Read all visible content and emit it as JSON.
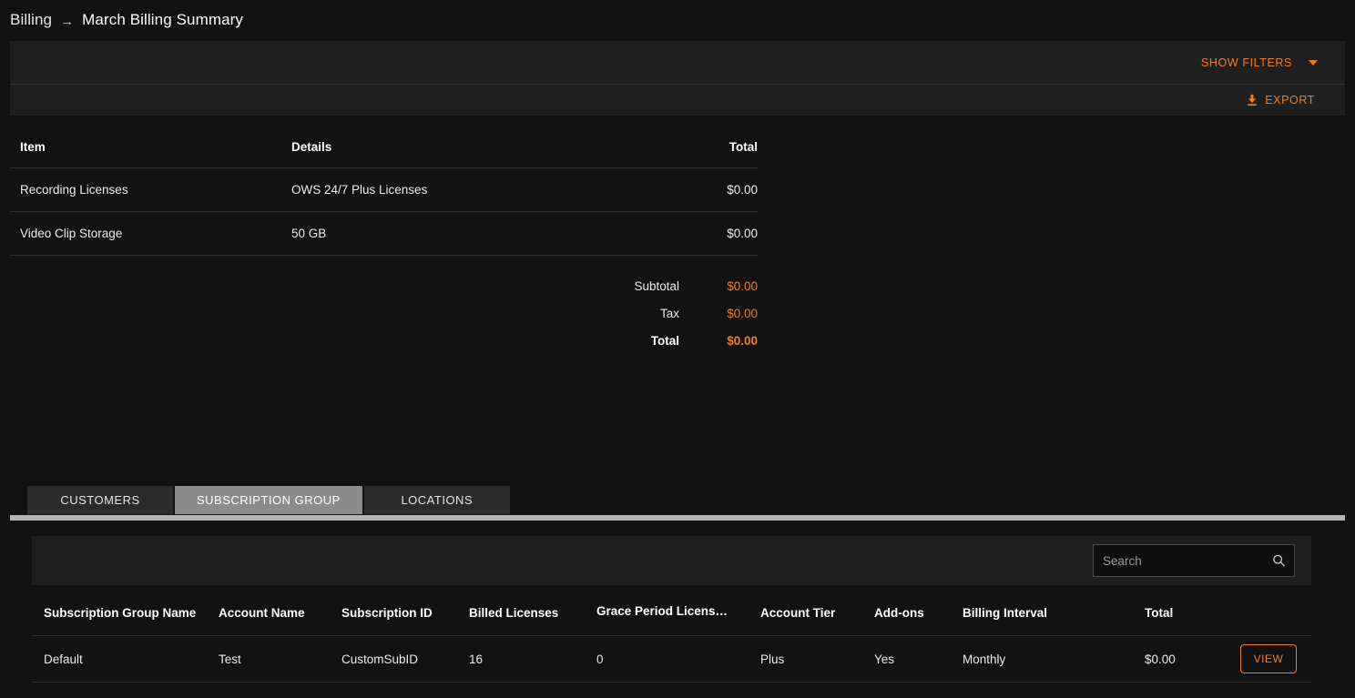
{
  "breadcrumb": {
    "root": "Billing",
    "arrow": "→",
    "current": "March Billing Summary"
  },
  "toolbar": {
    "show_filters_label": "SHOW FILTERS",
    "chevron_icon": "chevron-down-icon",
    "export_label": "EXPORT",
    "export_icon": "download-icon"
  },
  "summary_table": {
    "headers": {
      "item": "Item",
      "details": "Details",
      "total": "Total"
    },
    "rows": [
      {
        "item": "Recording Licenses",
        "details": "OWS 24/7 Plus Licenses",
        "total": "$0.00"
      },
      {
        "item": "Video Clip Storage",
        "details": "50 GB",
        "total": "$0.00"
      }
    ],
    "totals": [
      {
        "label": "Subtotal",
        "value": "$0.00"
      },
      {
        "label": "Tax",
        "value": "$0.00"
      },
      {
        "label": "Total",
        "value": "$0.00"
      }
    ]
  },
  "tabs": [
    {
      "label": "CUSTOMERS",
      "active": false
    },
    {
      "label": "SUBSCRIPTION GROUP",
      "active": true
    },
    {
      "label": "LOCATIONS",
      "active": false
    }
  ],
  "search": {
    "placeholder": "Search",
    "value": "",
    "icon": "search-icon"
  },
  "grid": {
    "headers": {
      "group_name": "Subscription Group Name",
      "account_name": "Account Name",
      "subscription_id": "Subscription ID",
      "billed_licenses": "Billed Licenses",
      "grace_period": "Grace Period Licens…",
      "account_tier": "Account Tier",
      "addons": "Add-ons",
      "billing_interval": "Billing Interval",
      "total": "Total"
    },
    "rows": [
      {
        "group_name": "Default",
        "account_name": "Test",
        "subscription_id": "CustomSubID",
        "billed_licenses": "16",
        "grace_period": "0",
        "account_tier": "Plus",
        "addons": "Yes",
        "billing_interval": "Monthly",
        "total": "$0.00",
        "action": "VIEW"
      }
    ]
  },
  "colors": {
    "accent": "#f07c20",
    "page_bg": "#121212",
    "panel_bg": "#1f1f1f",
    "tab_active_bg": "#8c8c8c"
  }
}
